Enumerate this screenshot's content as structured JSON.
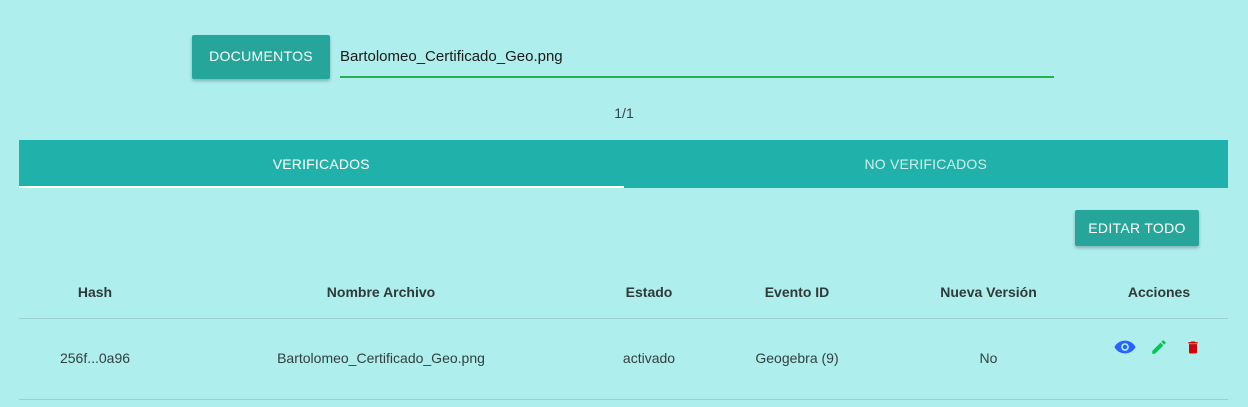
{
  "upload": {
    "button_label": "DOCUMENTOS",
    "file_name": "Bartolomeo_Certificado_Geo.png"
  },
  "pager": {
    "text": "1/1"
  },
  "tabs": [
    {
      "label": "VERIFICADOS",
      "active": true
    },
    {
      "label": "NO VERIFICADOS",
      "active": false
    }
  ],
  "toolbar": {
    "edit_all_label": "EDITAR TODO"
  },
  "table": {
    "headers": [
      "Hash",
      "Nombre Archivo",
      "Estado",
      "Evento ID",
      "Nueva Versión",
      "Acciones"
    ],
    "rows": [
      {
        "hash": "256f...0a96",
        "file_name": "Bartolomeo_Certificado_Geo.png",
        "status": "activado",
        "event_id": "Geogebra (9)",
        "new_version": "No",
        "actions": [
          "eye-icon",
          "pencil-icon",
          "trash-icon"
        ]
      }
    ]
  },
  "colors": {
    "background": "#aeeeec",
    "primary": "#26a69a",
    "tab_bar": "#20b2aa",
    "input_underline": "#26b04f",
    "view_icon": "#2962ff",
    "edit_icon": "#00c853",
    "delete_icon": "#d50000"
  }
}
